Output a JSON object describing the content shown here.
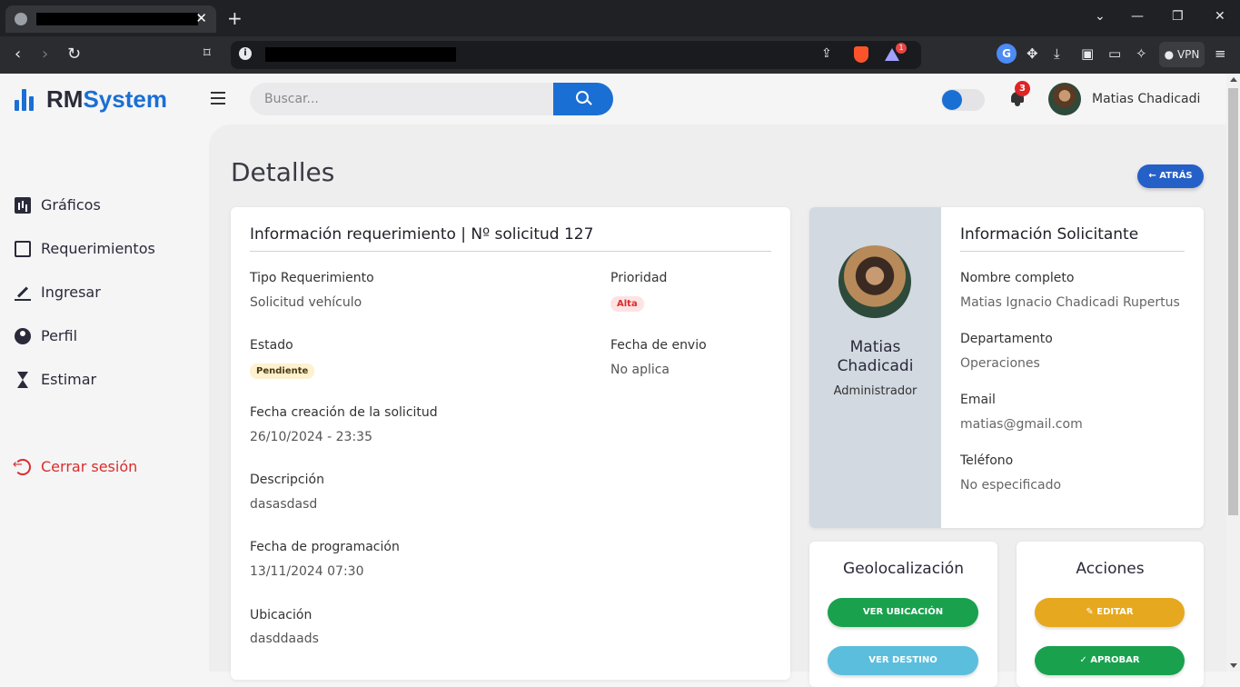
{
  "browser": {
    "tab_close": "✕",
    "new_tab": "+",
    "vpn_label": "VPN",
    "bat_badge": "1",
    "icons": [
      "globe-icon",
      "back-icon",
      "forward-icon",
      "reload-icon",
      "bookmark-icon",
      "info-icon",
      "share-icon",
      "brave-shield-icon",
      "rewards-icon",
      "translate-icon",
      "extensions-icon",
      "download-icon",
      "sidebar-icon",
      "wallet-icon",
      "leo-icon",
      "menu-icon"
    ]
  },
  "header": {
    "brand_rm": "RM",
    "brand_system": "System",
    "search_placeholder": "Buscar...",
    "notification_count": "3",
    "user_name": "Matias Chadicadi"
  },
  "sidebar": {
    "items": [
      {
        "label": "Gráficos",
        "icon": "bar-chart-icon"
      },
      {
        "label": "Requerimientos",
        "icon": "clipboard-icon"
      },
      {
        "label": "Ingresar",
        "icon": "pen-icon"
      },
      {
        "label": "Perfil",
        "icon": "user-circle-icon"
      },
      {
        "label": "Estimar",
        "icon": "hourglass-icon"
      }
    ],
    "logout": "Cerrar sesión"
  },
  "main": {
    "title": "Detalles",
    "back_button": "← ATRÁS",
    "request": {
      "title": "Información requerimiento | Nº solicitud 127",
      "tipo_label": "Tipo Requerimiento",
      "tipo_value": "Solicitud vehículo",
      "prioridad_label": "Prioridad",
      "prioridad_value": "Alta",
      "estado_label": "Estado",
      "estado_value": "Pendiente",
      "envio_label": "Fecha de envio",
      "envio_value": "No aplica",
      "creacion_label": "Fecha creación de la solicitud",
      "creacion_value": "26/10/2024 - 23:35",
      "descripcion_label": "Descripción",
      "descripcion_value": "dasasdasd",
      "programacion_label": "Fecha de programación",
      "programacion_value": "13/11/2024 07:30",
      "ubicacion_label": "Ubicación",
      "ubicacion_value": "dasddaads"
    },
    "requester": {
      "name_first": "Matias",
      "name_last": "Chadicadi",
      "role": "Administrador",
      "title": "Información Solicitante",
      "fullname_label": "Nombre completo",
      "fullname_value": "Matias Ignacio Chadicadi Rupertus",
      "dept_label": "Departamento",
      "dept_value": "Operaciones",
      "email_label": "Email",
      "email_value": "matias@gmail.com",
      "phone_label": "Teléfono",
      "phone_value": "No especificado"
    },
    "geo": {
      "title": "Geolocalización",
      "ver_ubicacion": "VER UBICACIÓN",
      "ver_destino": "VER DESTINO"
    },
    "actions": {
      "title": "Acciones",
      "editar": "EDITAR",
      "aprobar": "APROBAR"
    }
  },
  "colors": {
    "primary": "#1a6fd4",
    "danger": "#d92d2d",
    "success": "#19a14e",
    "warning": "#e6a81e",
    "info": "#5bbedc"
  }
}
